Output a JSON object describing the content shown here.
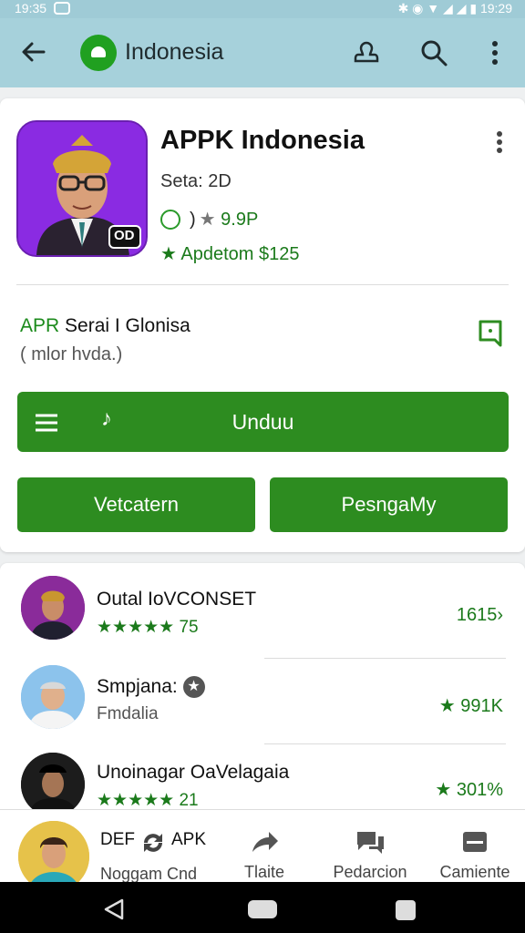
{
  "status": {
    "time_left": "19:35",
    "time_right": "19:29"
  },
  "appbar": {
    "title": "Indonesia"
  },
  "app": {
    "title": "APPK Indonesia",
    "meta": "Seta: 2D",
    "rating": "9.9P",
    "update": "Apdetom $125",
    "badge": "OD"
  },
  "section": {
    "title_accent": "APR",
    "title_rest": " Serai I Glonisa",
    "subtitle": "( mlor hvda.)"
  },
  "buttons": {
    "download": "Unduu",
    "left": "Vetcatern",
    "right": "PesngaMy"
  },
  "list": [
    {
      "name": "Outal IoVCONSET",
      "sub": "★★★★★ 75",
      "right": "1615›"
    },
    {
      "name": "Smpjana:",
      "sub": "Fmdalia",
      "right": "★ 991K"
    },
    {
      "name": "Unoinagar OaVelagaia",
      "sub": "★★★★★ 21",
      "right": "★ 301%"
    }
  ],
  "bottomnav": {
    "first_top": "DEF",
    "first_apk": "APK",
    "first_label": "Noggam Cnd",
    "items": [
      {
        "label": "Tlaite",
        "icon": "share-icon"
      },
      {
        "label": "Pedarcion",
        "icon": "chat-icon"
      },
      {
        "label": "Camiente",
        "icon": "folder-icon"
      }
    ]
  },
  "colors": {
    "accent": "#2d8c20",
    "appbar": "#a6d1db"
  }
}
